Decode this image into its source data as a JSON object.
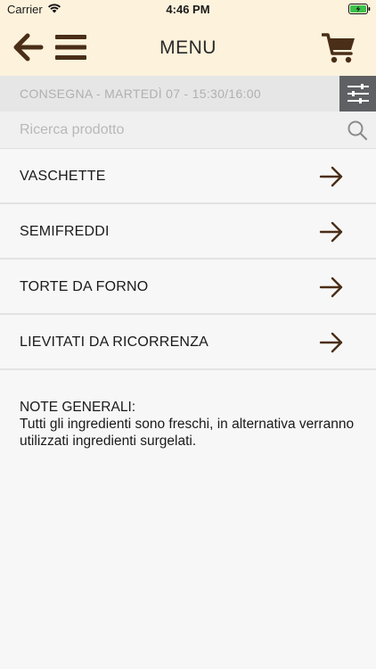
{
  "status_bar": {
    "carrier": "Carrier",
    "time": "4:46 PM"
  },
  "navbar": {
    "title": "MENU",
    "icons": [
      "back-arrow-icon",
      "hamburger-icon",
      "cart-icon"
    ],
    "icon_color": "#4a2e17",
    "background": "#fdf2dc"
  },
  "delivery": {
    "text": "CONSEGNA - MARTEDÌ 07 - 15:30/16:00"
  },
  "search": {
    "placeholder": "Ricerca prodotto",
    "value": ""
  },
  "categories": [
    {
      "label": "VASCHETTE"
    },
    {
      "label": "SEMIFREDDI"
    },
    {
      "label": "TORTE DA FORNO"
    },
    {
      "label": "LIEVITATI DA RICORRENZA"
    }
  ],
  "notes": {
    "heading": "NOTE GENERALI:",
    "body": "Tutti gli ingredienti sono freschi, in alternativa verranno utilizzati ingredienti surgelati."
  }
}
